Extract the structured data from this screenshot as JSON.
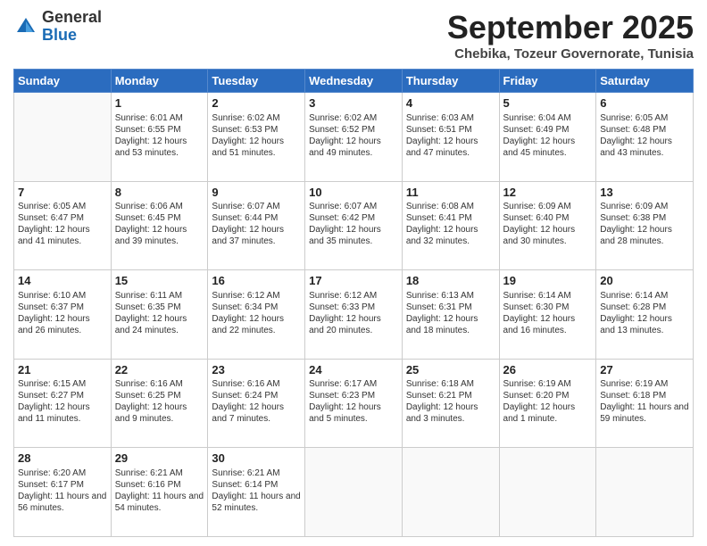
{
  "header": {
    "logo_general": "General",
    "logo_blue": "Blue",
    "month": "September 2025",
    "location": "Chebika, Tozeur Governorate, Tunisia"
  },
  "days_of_week": [
    "Sunday",
    "Monday",
    "Tuesday",
    "Wednesday",
    "Thursday",
    "Friday",
    "Saturday"
  ],
  "weeks": [
    [
      {
        "num": "",
        "sunrise": "",
        "sunset": "",
        "daylight": ""
      },
      {
        "num": "1",
        "sunrise": "6:01 AM",
        "sunset": "6:55 PM",
        "daylight": "12 hours and 53 minutes."
      },
      {
        "num": "2",
        "sunrise": "6:02 AM",
        "sunset": "6:53 PM",
        "daylight": "12 hours and 51 minutes."
      },
      {
        "num": "3",
        "sunrise": "6:02 AM",
        "sunset": "6:52 PM",
        "daylight": "12 hours and 49 minutes."
      },
      {
        "num": "4",
        "sunrise": "6:03 AM",
        "sunset": "6:51 PM",
        "daylight": "12 hours and 47 minutes."
      },
      {
        "num": "5",
        "sunrise": "6:04 AM",
        "sunset": "6:49 PM",
        "daylight": "12 hours and 45 minutes."
      },
      {
        "num": "6",
        "sunrise": "6:05 AM",
        "sunset": "6:48 PM",
        "daylight": "12 hours and 43 minutes."
      }
    ],
    [
      {
        "num": "7",
        "sunrise": "6:05 AM",
        "sunset": "6:47 PM",
        "daylight": "12 hours and 41 minutes."
      },
      {
        "num": "8",
        "sunrise": "6:06 AM",
        "sunset": "6:45 PM",
        "daylight": "12 hours and 39 minutes."
      },
      {
        "num": "9",
        "sunrise": "6:07 AM",
        "sunset": "6:44 PM",
        "daylight": "12 hours and 37 minutes."
      },
      {
        "num": "10",
        "sunrise": "6:07 AM",
        "sunset": "6:42 PM",
        "daylight": "12 hours and 35 minutes."
      },
      {
        "num": "11",
        "sunrise": "6:08 AM",
        "sunset": "6:41 PM",
        "daylight": "12 hours and 32 minutes."
      },
      {
        "num": "12",
        "sunrise": "6:09 AM",
        "sunset": "6:40 PM",
        "daylight": "12 hours and 30 minutes."
      },
      {
        "num": "13",
        "sunrise": "6:09 AM",
        "sunset": "6:38 PM",
        "daylight": "12 hours and 28 minutes."
      }
    ],
    [
      {
        "num": "14",
        "sunrise": "6:10 AM",
        "sunset": "6:37 PM",
        "daylight": "12 hours and 26 minutes."
      },
      {
        "num": "15",
        "sunrise": "6:11 AM",
        "sunset": "6:35 PM",
        "daylight": "12 hours and 24 minutes."
      },
      {
        "num": "16",
        "sunrise": "6:12 AM",
        "sunset": "6:34 PM",
        "daylight": "12 hours and 22 minutes."
      },
      {
        "num": "17",
        "sunrise": "6:12 AM",
        "sunset": "6:33 PM",
        "daylight": "12 hours and 20 minutes."
      },
      {
        "num": "18",
        "sunrise": "6:13 AM",
        "sunset": "6:31 PM",
        "daylight": "12 hours and 18 minutes."
      },
      {
        "num": "19",
        "sunrise": "6:14 AM",
        "sunset": "6:30 PM",
        "daylight": "12 hours and 16 minutes."
      },
      {
        "num": "20",
        "sunrise": "6:14 AM",
        "sunset": "6:28 PM",
        "daylight": "12 hours and 13 minutes."
      }
    ],
    [
      {
        "num": "21",
        "sunrise": "6:15 AM",
        "sunset": "6:27 PM",
        "daylight": "12 hours and 11 minutes."
      },
      {
        "num": "22",
        "sunrise": "6:16 AM",
        "sunset": "6:25 PM",
        "daylight": "12 hours and 9 minutes."
      },
      {
        "num": "23",
        "sunrise": "6:16 AM",
        "sunset": "6:24 PM",
        "daylight": "12 hours and 7 minutes."
      },
      {
        "num": "24",
        "sunrise": "6:17 AM",
        "sunset": "6:23 PM",
        "daylight": "12 hours and 5 minutes."
      },
      {
        "num": "25",
        "sunrise": "6:18 AM",
        "sunset": "6:21 PM",
        "daylight": "12 hours and 3 minutes."
      },
      {
        "num": "26",
        "sunrise": "6:19 AM",
        "sunset": "6:20 PM",
        "daylight": "12 hours and 1 minute."
      },
      {
        "num": "27",
        "sunrise": "6:19 AM",
        "sunset": "6:18 PM",
        "daylight": "11 hours and 59 minutes."
      }
    ],
    [
      {
        "num": "28",
        "sunrise": "6:20 AM",
        "sunset": "6:17 PM",
        "daylight": "11 hours and 56 minutes."
      },
      {
        "num": "29",
        "sunrise": "6:21 AM",
        "sunset": "6:16 PM",
        "daylight": "11 hours and 54 minutes."
      },
      {
        "num": "30",
        "sunrise": "6:21 AM",
        "sunset": "6:14 PM",
        "daylight": "11 hours and 52 minutes."
      },
      {
        "num": "",
        "sunrise": "",
        "sunset": "",
        "daylight": ""
      },
      {
        "num": "",
        "sunrise": "",
        "sunset": "",
        "daylight": ""
      },
      {
        "num": "",
        "sunrise": "",
        "sunset": "",
        "daylight": ""
      },
      {
        "num": "",
        "sunrise": "",
        "sunset": "",
        "daylight": ""
      }
    ]
  ]
}
